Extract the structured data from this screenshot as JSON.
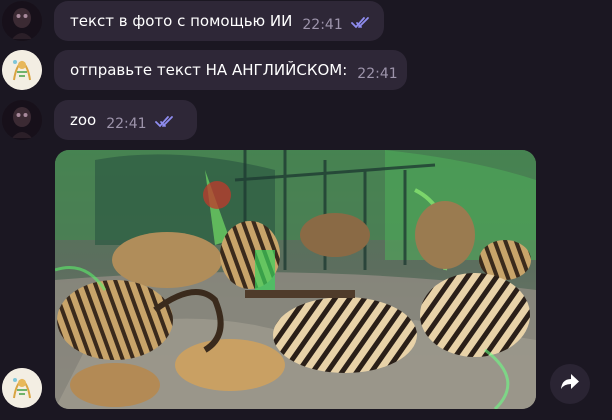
{
  "messages": [
    {
      "text": "текст в фото с помощью ИИ",
      "time": "22:41"
    },
    {
      "text": "отправьте текст НА АНГЛИЙСКОМ:",
      "time": "22:41"
    },
    {
      "text": "zoo",
      "time": "22:41"
    }
  ],
  "colors": {
    "background": "#1b1722",
    "bubble": "#2e2737",
    "time_text": "#9d94ab",
    "read_check": "#8f8df0"
  },
  "icons": [
    "double-check-icon",
    "forward-arrow-icon"
  ]
}
